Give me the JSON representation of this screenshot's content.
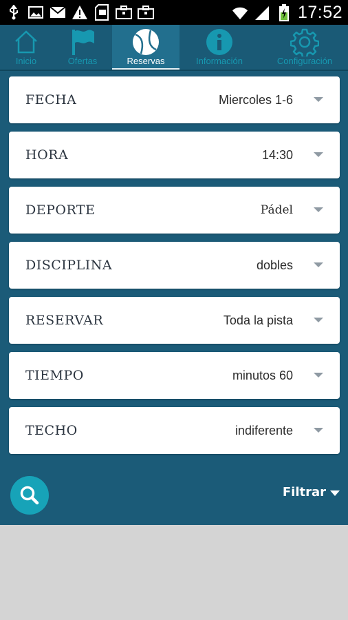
{
  "status_bar": {
    "time": "17:52",
    "icons": [
      "usb-icon",
      "image-icon",
      "mail-icon",
      "warning-icon",
      "sd-card-icon",
      "briefcase-icon",
      "briefcase-icon",
      "wifi-icon",
      "signal-icon",
      "battery-charging-icon"
    ]
  },
  "tabs": [
    {
      "label": "Inicio",
      "icon": "home-icon",
      "active": false
    },
    {
      "label": "Ofertas",
      "icon": "flag-icon",
      "active": false
    },
    {
      "label": "Reservas",
      "icon": "tennis-ball-icon",
      "active": true
    },
    {
      "label": "Información",
      "icon": "info-icon",
      "active": false
    },
    {
      "label": "Configuración",
      "icon": "gear-icon",
      "active": false
    }
  ],
  "form": {
    "fields": [
      {
        "label": "FECHA",
        "value": "Miercoles 1-6"
      },
      {
        "label": "HORA",
        "value": "14:30"
      },
      {
        "label": "DEPORTE",
        "value": "Pádel"
      },
      {
        "label": "DISCIPLINA",
        "value": "dobles"
      },
      {
        "label": "RESERVAR",
        "value": "Toda la pista"
      },
      {
        "label": "TIEMPO",
        "value": "minutos 60"
      },
      {
        "label": "TECHO",
        "value": "indiferente"
      }
    ]
  },
  "actions": {
    "search_icon": "search-icon",
    "filter_label": "Filtrar"
  },
  "colors": {
    "background": "#1b5b78",
    "accent": "#17a3b8",
    "tab_inactive": "#1798b0"
  }
}
